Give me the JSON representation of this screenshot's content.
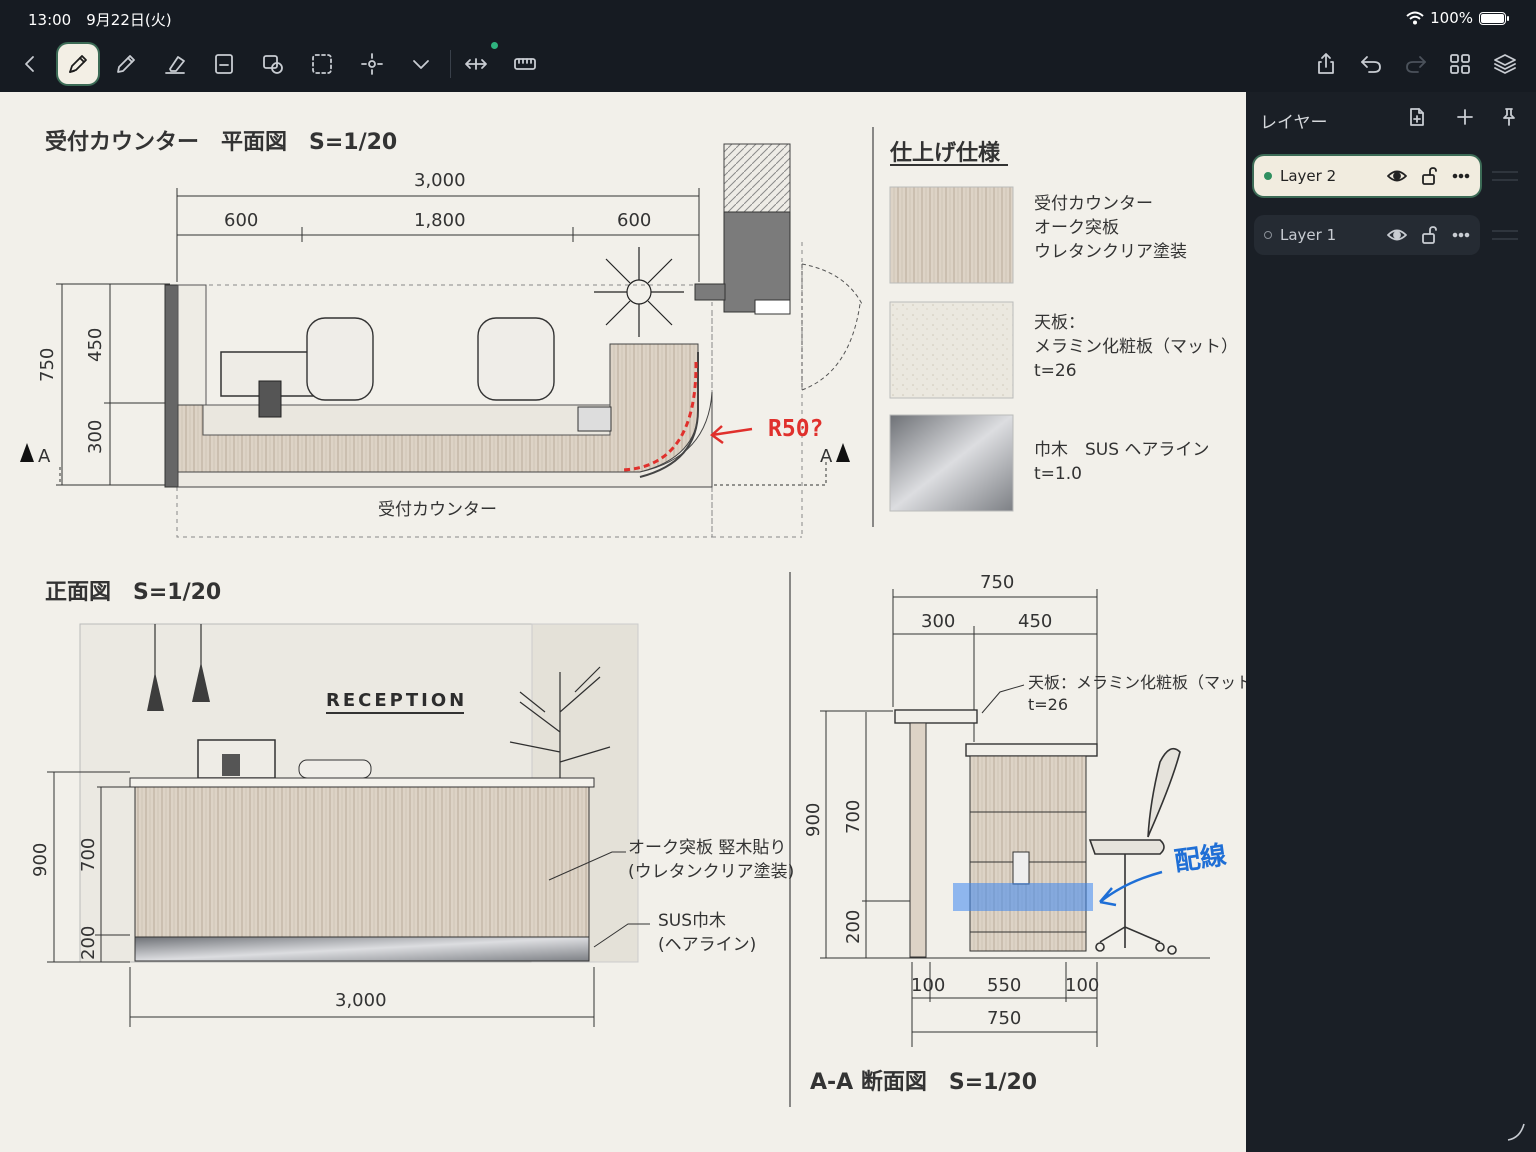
{
  "status": {
    "time": "13:00",
    "date": "9月22日(火)",
    "battery": "100%"
  },
  "toolbar": {
    "tools": [
      "back-icon",
      "pen-icon",
      "pencil-icon",
      "eraser-icon",
      "text-box-icon",
      "shapes-icon",
      "lasso-icon",
      "laser-pointer-icon",
      "more-tools-icon",
      "resize-icon",
      "ruler-icon"
    ],
    "right": [
      "share-icon",
      "undo-icon",
      "redo-icon",
      "grid-icon",
      "layers-icon"
    ]
  },
  "drawing": {
    "plan": {
      "title": "受付カウンター　平面図　S=1/20",
      "dim_total": "3,000",
      "dim_a": "600",
      "dim_b": "1,800",
      "dim_c": "600",
      "dim_750": "750",
      "dim_450": "450",
      "dim_300": "300",
      "section_a_left": "A",
      "section_a_right": "A",
      "counter_label": "受付カウンター",
      "markup_r50": "R50?"
    },
    "finish": {
      "title": "仕上げ仕様",
      "items": [
        {
          "lines": [
            "受付カウンター",
            "オーク突板",
            "ウレタンクリア塗装"
          ]
        },
        {
          "lines": [
            "天板：",
            "メラミン化粧板（マット）",
            "t=26"
          ]
        },
        {
          "lines": [
            "巾木　SUS ヘアライン",
            "t=1.0"
          ]
        }
      ]
    },
    "front": {
      "title": "正面図　S=1/20",
      "sign": "RECEPTION",
      "dim_900": "900",
      "dim_700": "700",
      "dim_200": "200",
      "dim_3000": "3,000",
      "note_oak_1": "オーク突板 竪木貼り",
      "note_oak_2": "(ウレタンクリア塗装)",
      "note_sus_1": "SUS巾木",
      "note_sus_2": "(ヘアライン)"
    },
    "section": {
      "title": "A-A 断面図　S=1/20",
      "dim_750_top": "750",
      "dim_300": "300",
      "dim_450": "450",
      "top_note_1": "天板：メラミン化粧板（マット）",
      "top_note_2": "t=26",
      "dim_900": "900",
      "dim_700": "700",
      "dim_200": "200",
      "dim_100_l": "100",
      "dim_550": "550",
      "dim_100_r": "100",
      "dim_750_bot": "750",
      "markup_wiring": "配線"
    }
  },
  "layers": {
    "title": "レイヤー",
    "items": [
      {
        "name": "Layer 2",
        "selected": true,
        "dot_color": "#2f8f5f"
      },
      {
        "name": "Layer 1",
        "selected": false,
        "dot_color": "#8a9098"
      }
    ]
  },
  "colors": {
    "accent": "#3c6b56",
    "markup_red": "#e0302c",
    "markup_blue": "#1f6fd6"
  }
}
